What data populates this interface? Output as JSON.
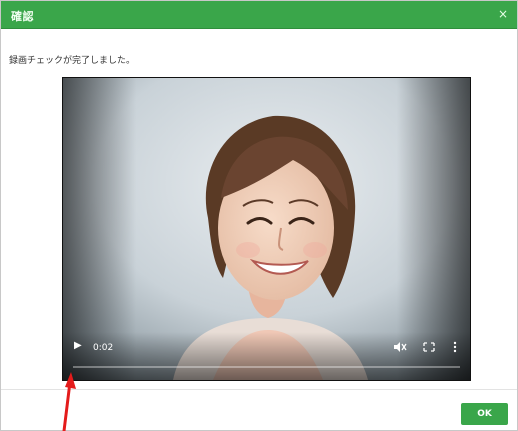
{
  "dialog": {
    "title": "確認",
    "close_glyph": "×",
    "message": "録画チェックが完了しました。"
  },
  "video": {
    "time": "0:02",
    "progress": 0.0,
    "controls": {
      "play_icon": "play-icon",
      "mute_icon": "mute-icon",
      "fullscreen_icon": "fullscreen-icon",
      "more_icon": "more-icon"
    }
  },
  "footer": {
    "ok_label": "OK"
  },
  "colors": {
    "accent": "#3aa64a",
    "annotation_arrow": "#e41b1b"
  }
}
